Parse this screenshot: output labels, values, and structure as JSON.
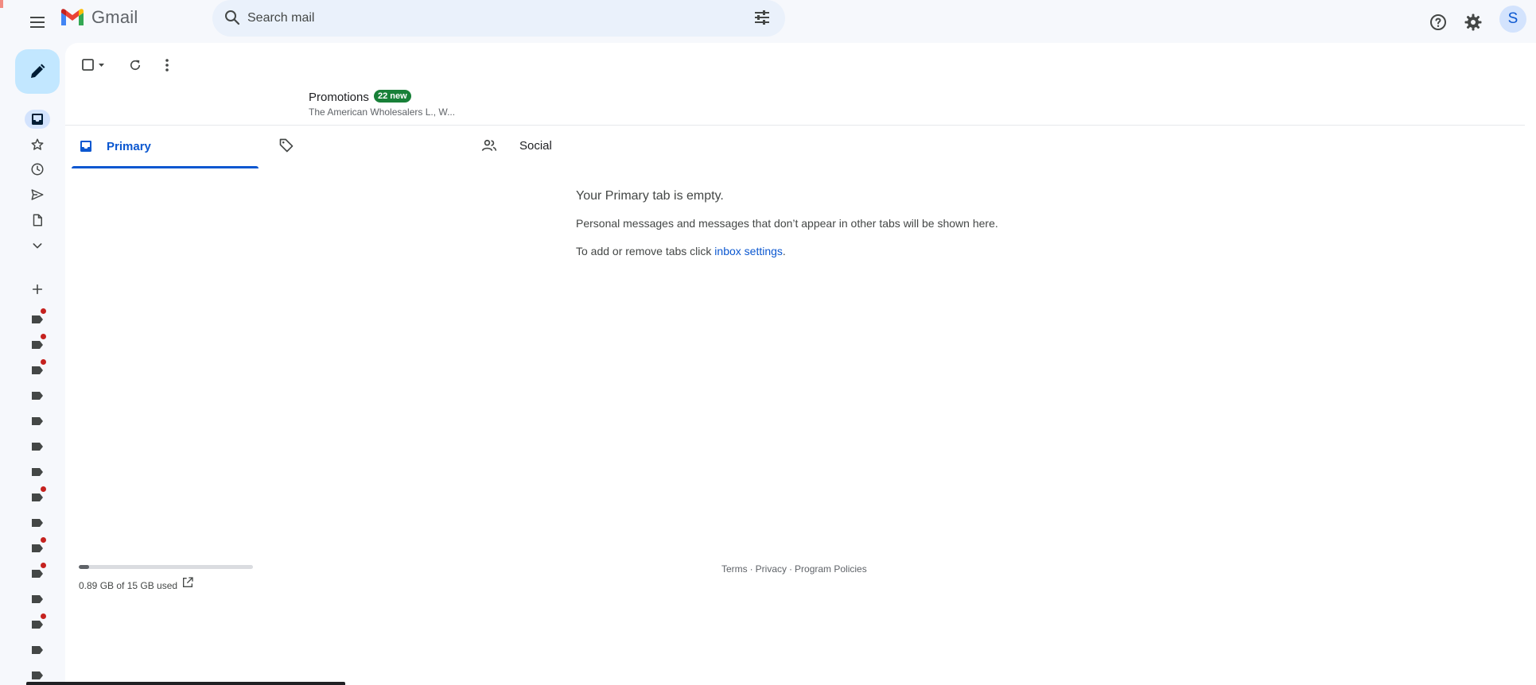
{
  "app": {
    "name": "Gmail"
  },
  "search": {
    "placeholder": "Search mail"
  },
  "user": {
    "avatar_letter": "S"
  },
  "tabs": [
    {
      "label": "Primary",
      "active": true
    },
    {
      "label": "Promotions",
      "badge": "22 new",
      "subtitle": "The American Wholesalers L., W..."
    },
    {
      "label": "Social"
    }
  ],
  "empty_state": {
    "title": "Your Primary tab is empty.",
    "description": "Personal messages and messages that don’t appear in other tabs will be shown here.",
    "tip_prefix": "To add or remove tabs click ",
    "tip_link": "inbox settings",
    "tip_suffix": "."
  },
  "storage": {
    "text": "0.89 GB of 15 GB used",
    "fraction_used": 0.059
  },
  "footer": {
    "terms": "Terms",
    "privacy": "Privacy",
    "policies": "Program Policies",
    "separator": "·"
  },
  "rail_icons": [
    "inbox-icon",
    "star-icon",
    "clock-icon",
    "send-icon",
    "draft-icon",
    "chevron-down-icon",
    "plus-icon"
  ],
  "labels_unread": [
    true,
    true,
    true,
    false,
    false,
    false,
    false,
    true,
    false,
    true,
    true,
    false,
    true,
    false,
    false
  ],
  "colors": {
    "accent": "#0b57d0",
    "badge": "#188038",
    "unread_dot": "#c5221f",
    "compose": "#c2e7ff"
  }
}
